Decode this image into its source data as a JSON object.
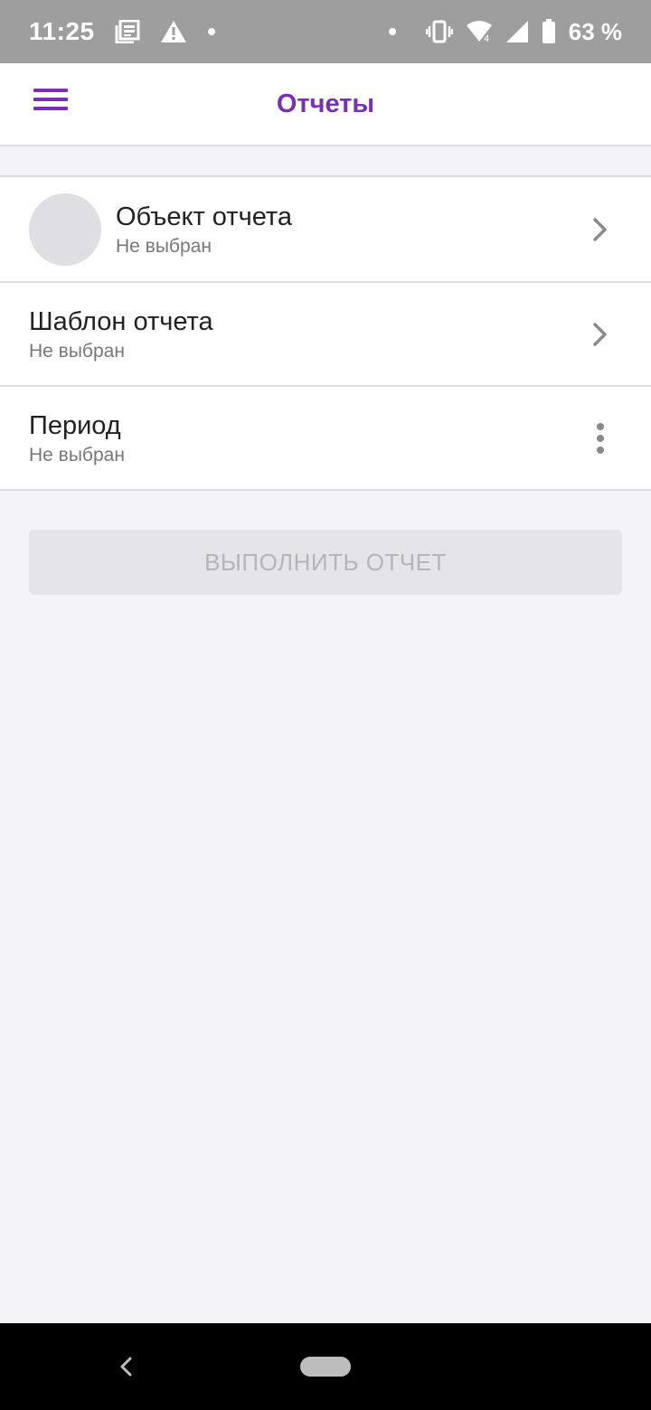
{
  "status_bar": {
    "time": "11:25",
    "battery": "63 %",
    "icons": [
      "news-icon",
      "warning-icon",
      "dot-icon",
      "dot-icon",
      "vibrate-icon",
      "wifi-icon",
      "signal-icon",
      "battery-icon"
    ]
  },
  "app_bar": {
    "title": "Отчеты",
    "menu_icon": "hamburger-menu-icon"
  },
  "list": {
    "items": [
      {
        "title": "Объект отчета",
        "subtitle": "Не выбран",
        "action_icon": "chevron-right-icon"
      },
      {
        "title": "Шаблон отчета",
        "subtitle": "Не выбран",
        "action_icon": "chevron-right-icon"
      },
      {
        "title": "Период",
        "subtitle": "Не выбран",
        "action_icon": "more-vert-icon"
      }
    ]
  },
  "execute_button": {
    "label": "ВЫПОЛНИТЬ ОТЧЕТ",
    "enabled": false
  },
  "colors": {
    "accent": "#7b2fb5",
    "background": "#f4f4f8",
    "status_bar": "#9e9e9e",
    "button_disabled_bg": "#e4e4e9",
    "button_disabled_text": "#b4b4bb"
  }
}
